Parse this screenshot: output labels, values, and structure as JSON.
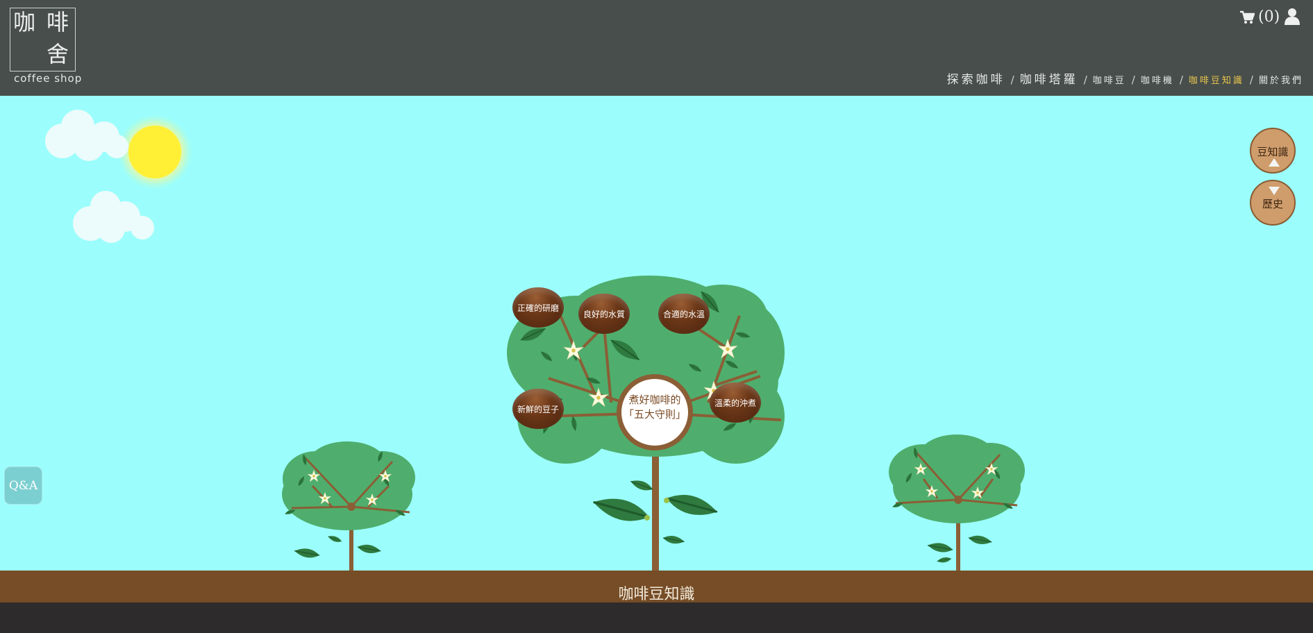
{
  "header": {
    "logo": {
      "char1": "咖",
      "char2": "啡",
      "char3": "舍",
      "subtitle": "coffee shop"
    },
    "cart": {
      "icon": "cart-icon",
      "count_text": "(0)"
    },
    "user_icon": "user-icon",
    "nav": [
      {
        "label": "探索咖啡"
      },
      {
        "label": "咖啡塔羅"
      },
      {
        "label": "咖啡豆"
      },
      {
        "label": "咖啡機"
      },
      {
        "label": "咖啡豆知識"
      },
      {
        "label": "關於我們"
      }
    ],
    "nav_separator": "/",
    "active_color": "#ebc64e"
  },
  "side_buttons": {
    "knowledge": "豆知識",
    "history": "歷史"
  },
  "qa_button": "Q&A",
  "tree": {
    "center_line1": "煮好咖啡的",
    "center_line2": "「五大守則」",
    "beans": [
      {
        "label": "正確的研磨"
      },
      {
        "label": "良好的水質"
      },
      {
        "label": "合適的水溫"
      },
      {
        "label": "新鮮的豆子"
      },
      {
        "label": "溫柔的沖煮"
      }
    ]
  },
  "ground_label": "咖啡豆知識",
  "colors": {
    "sky": "#9bfefc",
    "ground": "#764d26",
    "header": "#474e4b",
    "canopy": "#4fae6d"
  }
}
